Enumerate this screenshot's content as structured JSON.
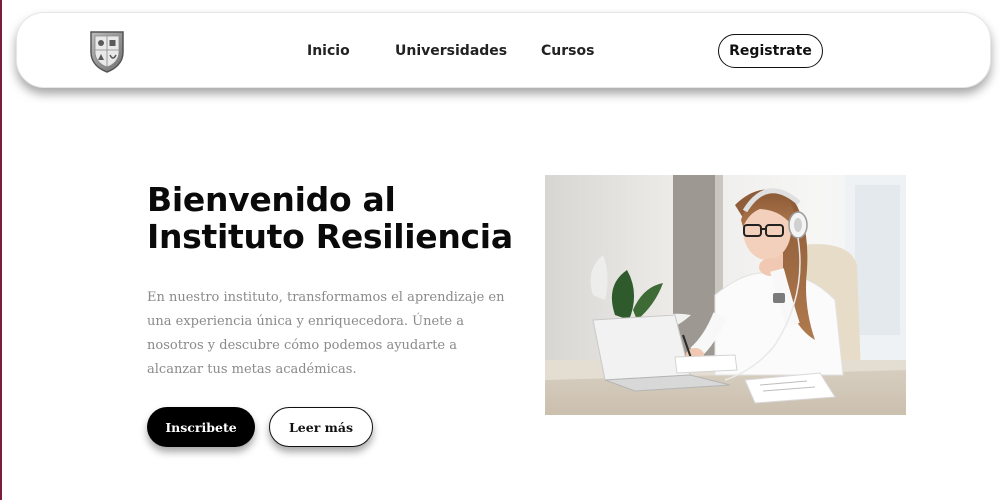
{
  "nav": {
    "links": [
      "Inicio",
      "Universidades",
      "Cursos"
    ],
    "register_label": "Registrate",
    "logo_icon": "shield-crest-icon"
  },
  "hero": {
    "title_line1": "Bienvenido al",
    "title_line2": "Instituto Resiliencia",
    "description": "En nuestro instituto, transformamos el aprendizaje en una experiencia única y enriquecedora. Únete a nosotros y descubre cómo podemos ayudarte a alcanzar tus metas académicas.",
    "primary_button": "Inscribete",
    "secondary_button": "Leer más",
    "image_icon": "student-studying-photo"
  },
  "colors": {
    "accent_dark": "#000000",
    "text_body": "#8a8a8a",
    "left_edge": "#7a1d3a"
  }
}
